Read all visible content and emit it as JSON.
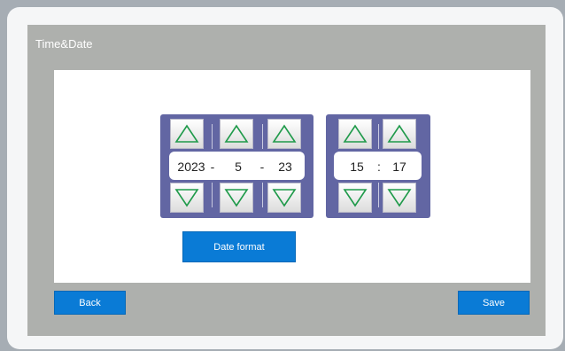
{
  "window": {
    "title": "Time&Date"
  },
  "date": {
    "year": "2023",
    "month": "5",
    "day": "23",
    "separator1": "-",
    "separator2": "-"
  },
  "time": {
    "hour": "15",
    "minute": "17",
    "separator": ":"
  },
  "buttons": {
    "date_format": "Date format",
    "back": "Back",
    "save": "Save"
  },
  "icons": {
    "up": "chevron-up-icon",
    "down": "chevron-down-icon"
  },
  "colors": {
    "accent": "#0a7bd6",
    "spinner_frame": "#6266a3",
    "arrow": "#1f9a4a",
    "panel": "#aeb0ad"
  }
}
